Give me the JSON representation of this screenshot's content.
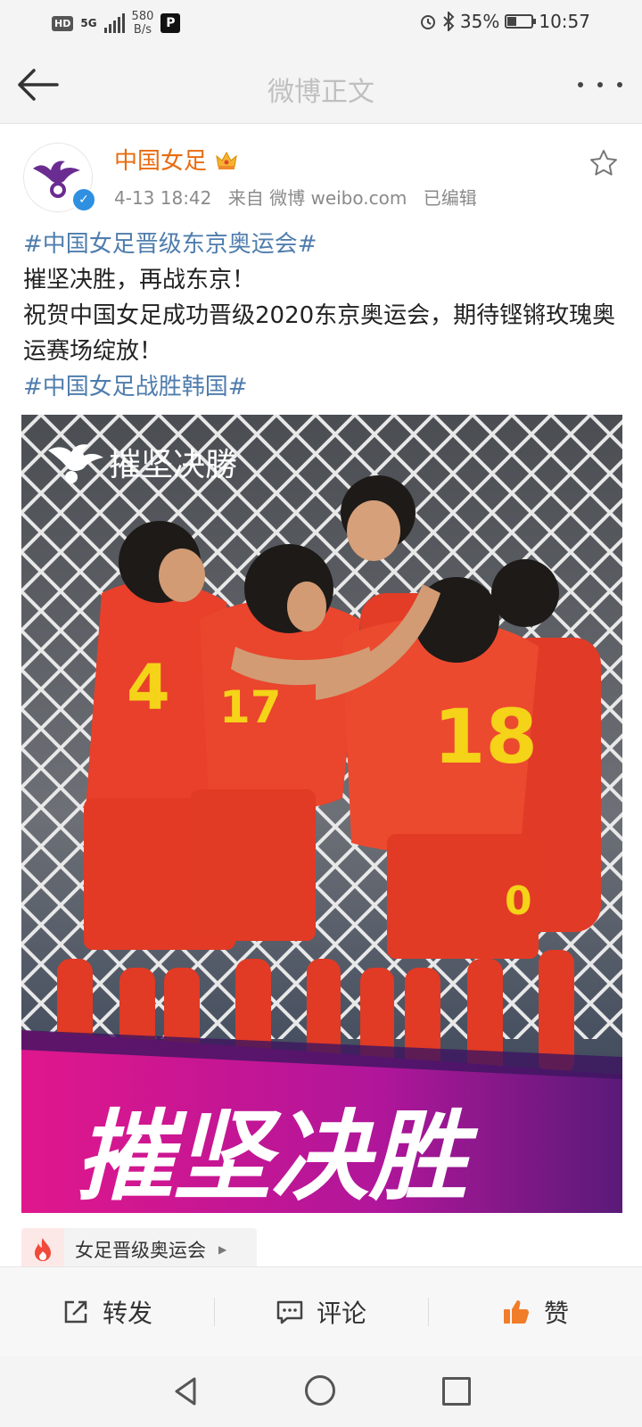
{
  "status_bar": {
    "hd": "HD",
    "network": "5G",
    "speed_value": "580",
    "speed_unit": "B/s",
    "app_badge": "P",
    "battery": "35%",
    "time": "10:57"
  },
  "nav": {
    "title": "微博正文"
  },
  "post": {
    "author": "中国女足",
    "date": "4-13 18:42",
    "source": "来自 微博 weibo.com",
    "edited": "已编辑",
    "verified": "✓",
    "hashtag_1": "#中国女足晋级东京奥运会#",
    "line_1": "摧坚决胜，再战东京！",
    "line_2": "祝贺中国女足成功晋级2020东京奥运会，期待铿锵玫瑰奥运赛场绽放！",
    "hashtag_2": "#中国女足战胜韩国#"
  },
  "image": {
    "overlay_title": "摧坚决勝",
    "banner_text": "摧坚决胜",
    "jersey_numbers": [
      "4",
      "17",
      "18",
      "0"
    ]
  },
  "topic": {
    "label": "女足晋级奥运会"
  },
  "actions": {
    "repost": "转发",
    "comment": "评论",
    "like": "赞"
  },
  "colors": {
    "author": "#e86b10",
    "hashtag": "#4f7dad",
    "like_icon": "#f07d2a",
    "banner_magenta": "#d2198a",
    "banner_purple": "#5a1a78",
    "jersey_red": "#e8402b"
  },
  "icons": [
    "back-arrow-icon",
    "more-icon",
    "star-icon",
    "fire-icon",
    "repost-icon",
    "comment-icon",
    "like-icon"
  ]
}
